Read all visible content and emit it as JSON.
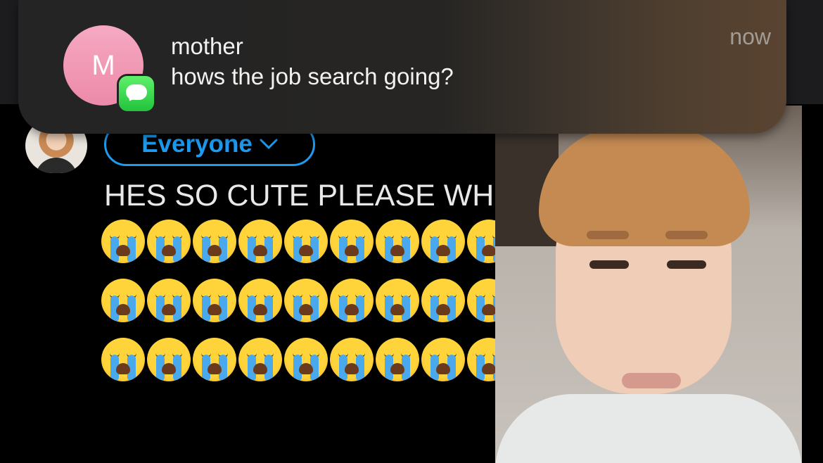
{
  "notification": {
    "avatar_letter": "M",
    "sender": "mother",
    "message": "hows the job search going?",
    "time": "now",
    "app_icon": "messages-icon",
    "avatar_color": "#f29ab7"
  },
  "composer": {
    "audience_label": "Everyone",
    "audience_color": "#1d9bf0",
    "tweet_text": "HES SO CUTE PLEASE WH",
    "emoji_rows": [
      [
        "😭",
        "😭",
        "😭",
        "😭",
        "😭",
        "😭",
        "😭",
        "😭",
        "😭"
      ],
      [
        "😭",
        "😭",
        "😭",
        "😭",
        "😭",
        "😭",
        "😭",
        "😭",
        "😭"
      ],
      [
        "😭",
        "😭",
        "😭",
        "😭",
        "😭",
        "😭",
        "😭",
        "😭",
        "😭"
      ]
    ]
  }
}
